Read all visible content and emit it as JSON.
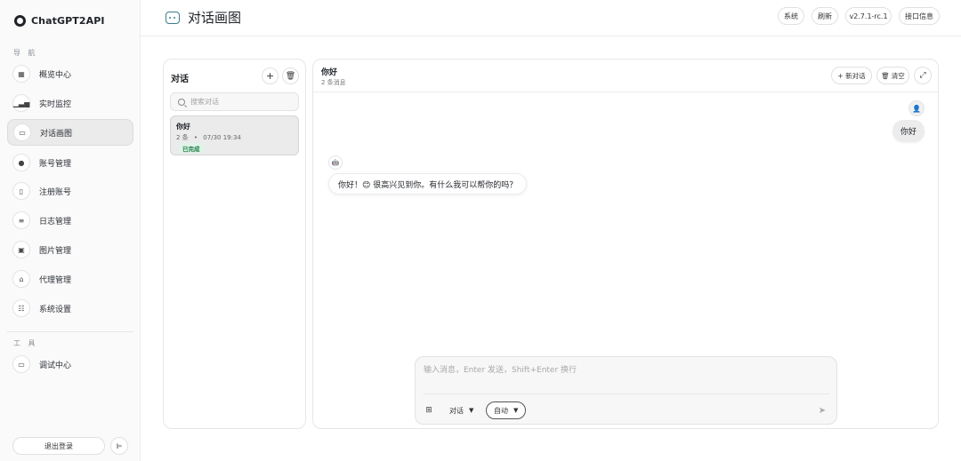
{
  "app": {
    "title": "ChatGPT2API"
  },
  "sidebar": {
    "nav_label": "导 航",
    "nav_items": [
      {
        "label": "概览中心",
        "icon": "grid-icon"
      },
      {
        "label": "实时监控",
        "icon": "bar-chart-icon"
      },
      {
        "label": "对话画图",
        "icon": "chat-icon",
        "active": true
      },
      {
        "label": "账号管理",
        "icon": "user-icon"
      },
      {
        "label": "注册账号",
        "icon": "register-icon"
      },
      {
        "label": "日志管理",
        "icon": "log-icon"
      },
      {
        "label": "图片管理",
        "icon": "image-icon"
      },
      {
        "label": "代理管理",
        "icon": "lock-icon"
      },
      {
        "label": "系统设置",
        "icon": "settings-icon"
      }
    ],
    "tools_label": "工 具",
    "tool_items": [
      {
        "label": "调试中心",
        "icon": "debug-icon"
      }
    ],
    "logout_label": "退出登录"
  },
  "header": {
    "title": "对话画图",
    "buttons": {
      "system": "系统",
      "refresh": "刷新",
      "version": "v2.7.1-rc.1",
      "api_info": "接口信息"
    }
  },
  "conversations": {
    "title": "对话",
    "search_placeholder": "搜索对话",
    "items": [
      {
        "title": "你好",
        "count": "2 条",
        "separator": "•",
        "time": "07/30 19:34",
        "status": "已完成"
      }
    ]
  },
  "chat": {
    "title": "你好",
    "subtitle": "2 条消息",
    "buttons": {
      "new_chat": "+ 新对话",
      "clear": "清空"
    },
    "messages": [
      {
        "role": "user",
        "text": "你好"
      },
      {
        "role": "assistant",
        "text": "你好！😊 很高兴见到你。有什么我可以帮你的吗？"
      }
    ],
    "composer": {
      "placeholder": "输入消息，Enter 发送，Shift+Enter 换行",
      "mode": "对话",
      "auto": "自动"
    }
  }
}
